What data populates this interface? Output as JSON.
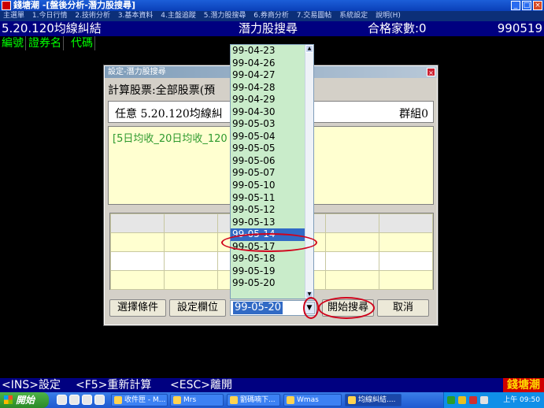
{
  "window": {
    "title": "錢塘潮 -[盤後分析-潛力股搜尋]",
    "controls": [
      "_",
      "□",
      "×"
    ]
  },
  "menubar": [
    "主選單",
    "1.今日行情",
    "2.技術分析",
    "3.基本資料",
    "4.主盤追蹤",
    "5.潛力股搜尋",
    "6.券商分析",
    "7.交易圖帖",
    "系統設定",
    "說明(H)"
  ],
  "infobar": {
    "pattern": "5.20.120均線糾結",
    "screen": "潛力股搜尋",
    "count_label": "合格家數:0",
    "date": "990519"
  },
  "columns": [
    "編號",
    "證券名",
    "代碼"
  ],
  "dialog": {
    "title": "設定-潛力股搜尋",
    "calc_label": "計算股票:全部股票(預",
    "pattern_label": "任意 5.20.120均線糾",
    "group_label": "群組0",
    "condition_text": "[5日均收_20日均收_120",
    "buttons": {
      "select_condition": "選擇條件",
      "set_field": "設定欄位",
      "start_search": "開始搜尋",
      "cancel": "取消"
    },
    "date_selected": "99-05-20"
  },
  "dropdown": {
    "dates": [
      "99-04-23",
      "99-04-26",
      "99-04-27",
      "99-04-28",
      "99-04-29",
      "99-04-30",
      "99-05-03",
      "99-05-04",
      "99-05-05",
      "99-05-06",
      "99-05-07",
      "99-05-10",
      "99-05-11",
      "99-05-12",
      "99-05-13",
      "99-05-14",
      "99-05-17",
      "99-05-18",
      "99-05-19",
      "99-05-20"
    ],
    "highlighted": "99-05-14"
  },
  "statusbar": {
    "ins": "<INS>設定",
    "f5": "<F5>重新計算",
    "esc": "<ESC>離開",
    "brand": "錢塘潮"
  },
  "taskbar": {
    "start": "開始",
    "tasks": [
      "收件匣 - M...",
      "Mrs",
      "劉碼喃下...",
      "Wmas",
      "均線糾結...."
    ],
    "clock": "上午 09:50"
  }
}
